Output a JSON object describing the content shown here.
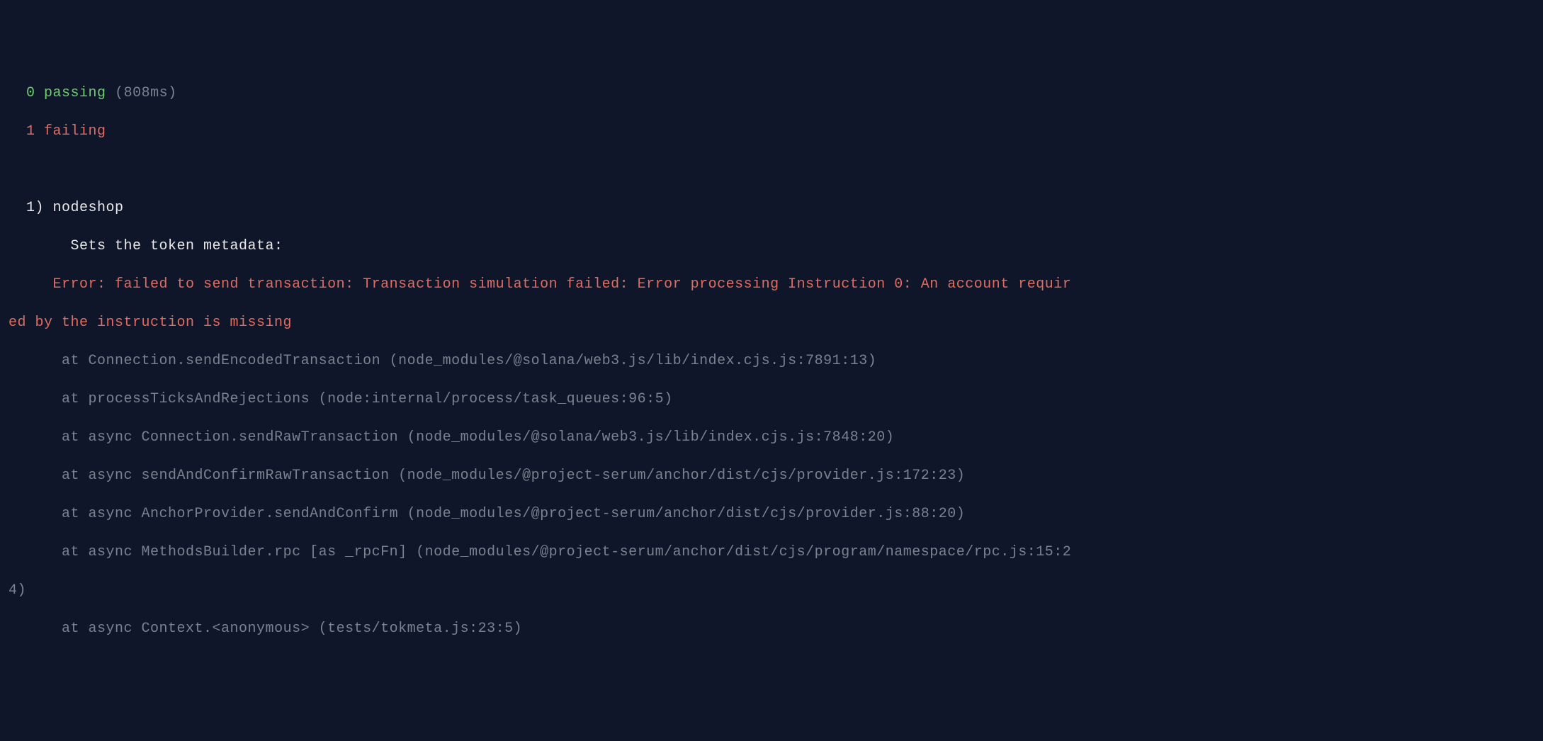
{
  "summary": {
    "passing_count": "0",
    "passing_label": "passing",
    "passing_time": "(808ms)",
    "failing_count": "1",
    "failing_label": "failing"
  },
  "test": {
    "number": "1)",
    "suite": "nodeshop",
    "title": "Sets the token metadata:",
    "error_line1": "     Error: failed to send transaction: Transaction simulation failed: Error processing Instruction 0: An account requir",
    "error_line2": "ed by the instruction is missing",
    "stack": [
      "      at Connection.sendEncodedTransaction (node_modules/@solana/web3.js/lib/index.cjs.js:7891:13)",
      "      at processTicksAndRejections (node:internal/process/task_queues:96:5)",
      "      at async Connection.sendRawTransaction (node_modules/@solana/web3.js/lib/index.cjs.js:7848:20)",
      "      at async sendAndConfirmRawTransaction (node_modules/@project-serum/anchor/dist/cjs/provider.js:172:23)",
      "      at async AnchorProvider.sendAndConfirm (node_modules/@project-serum/anchor/dist/cjs/provider.js:88:20)",
      "      at async MethodsBuilder.rpc [as _rpcFn] (node_modules/@project-serum/anchor/dist/cjs/program/namespace/rpc.js:15:2",
      "4)",
      "      at async Context.<anonymous> (tests/tokmeta.js:23:5)"
    ]
  }
}
